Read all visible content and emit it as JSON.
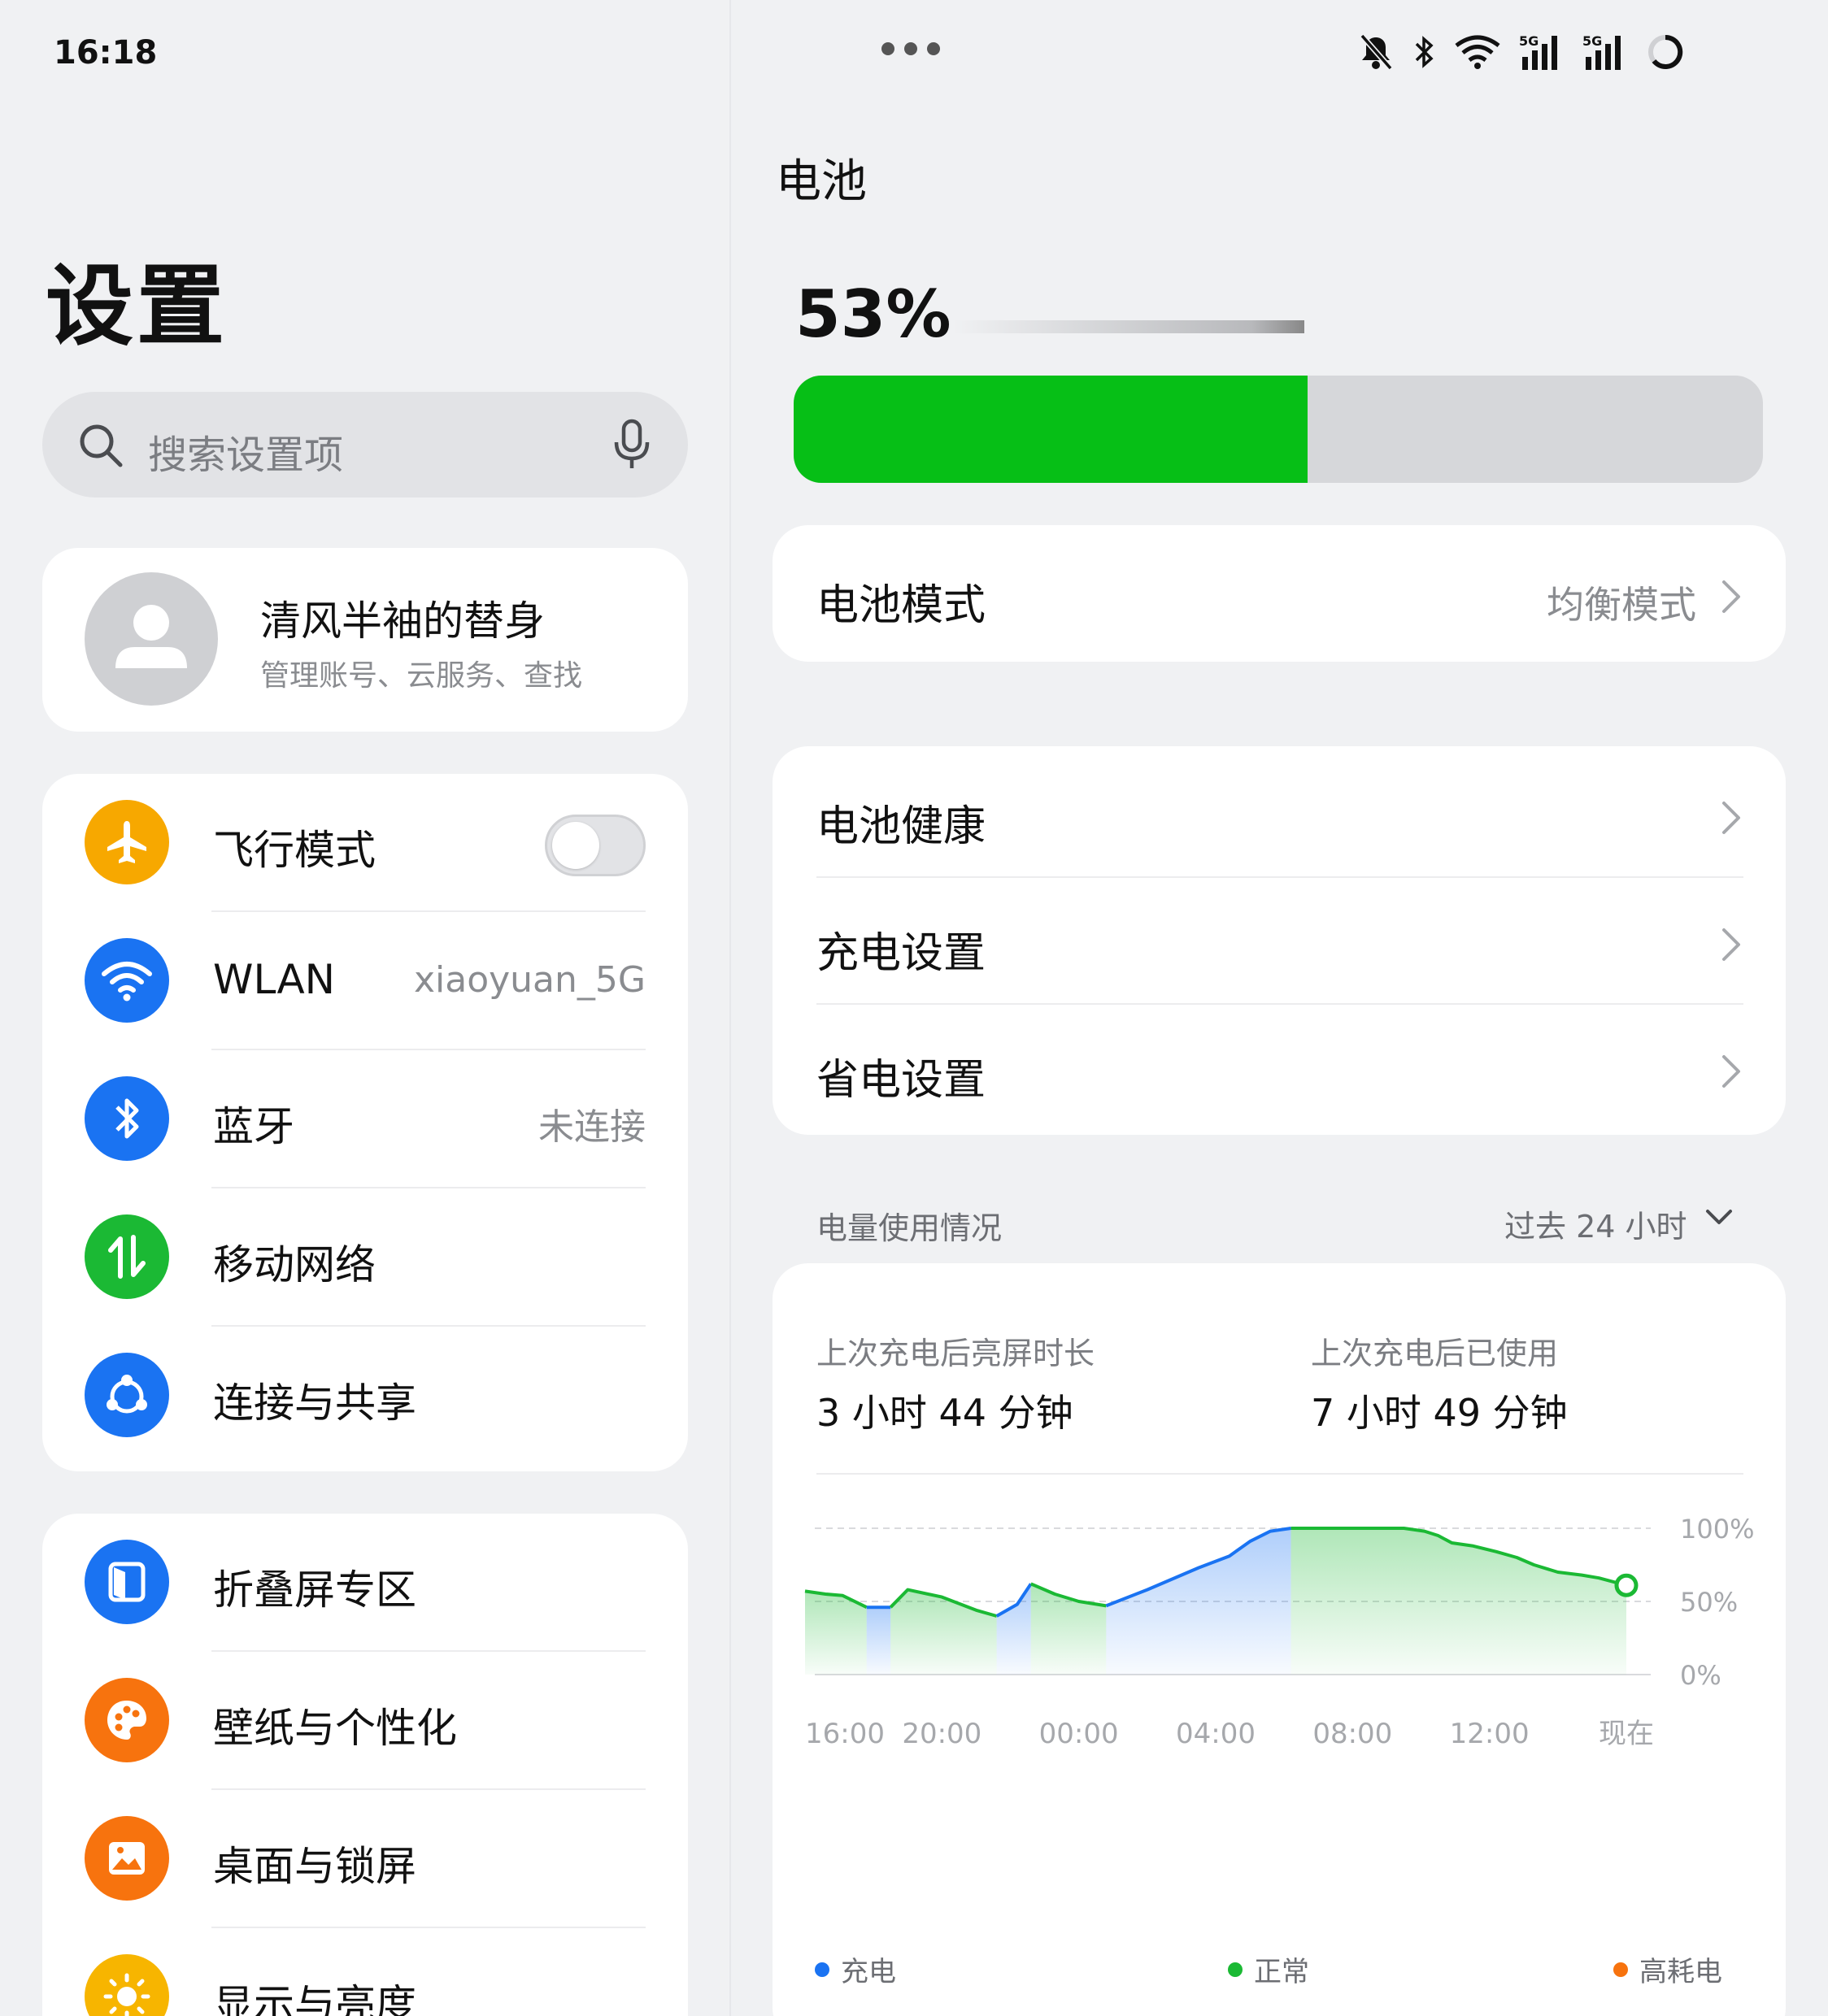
{
  "status_bar": {
    "time": "16:18",
    "icons": [
      "mute-bell-icon",
      "bluetooth-icon",
      "wifi-icon",
      "signal-5g-icon",
      "signal-5g-icon",
      "battery-ring-icon"
    ]
  },
  "left": {
    "title": "设置",
    "search": {
      "placeholder": "搜索设置项"
    },
    "account": {
      "name": "清风半袖的替身",
      "subtitle": "管理账号、云服务、查找"
    },
    "group1": [
      {
        "label": "飞行模式",
        "icon": "airplane-icon",
        "color": "#f7a800",
        "toggle": false
      },
      {
        "label": "WLAN",
        "value": "xiaoyuan_5G",
        "icon": "wifi-icon",
        "color": "#1a73f2"
      },
      {
        "label": "蓝牙",
        "value": "未连接",
        "icon": "bluetooth-icon",
        "color": "#1a73f2"
      },
      {
        "label": "移动网络",
        "icon": "mobile-data-icon",
        "color": "#1bb934"
      },
      {
        "label": "连接与共享",
        "icon": "share-icon",
        "color": "#1a73f2"
      }
    ],
    "group2": [
      {
        "label": "折叠屏专区",
        "icon": "foldable-icon",
        "color": "#1a73f2"
      },
      {
        "label": "壁纸与个性化",
        "icon": "palette-icon",
        "color": "#f7730e"
      },
      {
        "label": "桌面与锁屏",
        "icon": "wallpaper-icon",
        "color": "#f7730e"
      },
      {
        "label": "显示与亮度",
        "icon": "sun-icon",
        "color": "#f7b500"
      }
    ]
  },
  "right": {
    "title": "电池",
    "percent_text": "53%",
    "level": 0.53,
    "fill_color": "#06bf16",
    "mode": {
      "label": "电池模式",
      "value": "均衡模式"
    },
    "menu": [
      "电池健康",
      "充电设置",
      "省电设置"
    ],
    "usage": {
      "heading": "电量使用情况",
      "range": "过去 24 小时",
      "screen_on_label": "上次充电后亮屏时长",
      "screen_on_value": "3 小时 44 分钟",
      "used_label": "上次充电后已使用",
      "used_value": "7 小时 49 分钟"
    }
  },
  "chart_data": {
    "type": "area",
    "title": "",
    "x_ticks": [
      "16:00",
      "20:00",
      "00:00",
      "04:00",
      "08:00",
      "12:00",
      "现在"
    ],
    "y_ticks": [
      "100%",
      "50%",
      "0%"
    ],
    "ylim": [
      0,
      100
    ],
    "xlim": [
      0,
      24
    ],
    "grid": true,
    "series": [
      {
        "name": "充电",
        "color": "#1a73f2",
        "points": [
          [
            0,
            57
          ],
          [
            0.6,
            55
          ],
          [
            1.1,
            54
          ],
          [
            1.8,
            46
          ],
          [
            2.5,
            46
          ],
          [
            3.0,
            58
          ],
          [
            4.0,
            53
          ],
          [
            5.0,
            44
          ],
          [
            5.6,
            40
          ],
          [
            6.2,
            48
          ],
          [
            6.6,
            62
          ],
          [
            7.3,
            55
          ],
          [
            8.0,
            50
          ],
          [
            8.8,
            47
          ],
          [
            10.0,
            58
          ],
          [
            11.5,
            73
          ],
          [
            12.4,
            81
          ],
          [
            13.0,
            91
          ],
          [
            13.6,
            98
          ],
          [
            14.2,
            100
          ],
          [
            17.5,
            100
          ],
          [
            18.1,
            98
          ],
          [
            18.5,
            95
          ],
          [
            18.9,
            90
          ],
          [
            19.5,
            88
          ],
          [
            20.2,
            84
          ],
          [
            20.8,
            80
          ],
          [
            21.3,
            75
          ],
          [
            22.0,
            70
          ],
          [
            22.7,
            68
          ],
          [
            23.2,
            66
          ],
          [
            24.0,
            61
          ]
        ]
      }
    ],
    "legend": [
      {
        "name": "充电",
        "color": "#1a73f2"
      },
      {
        "name": "正常",
        "color": "#1bb934"
      },
      {
        "name": "高耗电",
        "color": "#f7730e"
      }
    ],
    "legend_position": "bottom"
  }
}
